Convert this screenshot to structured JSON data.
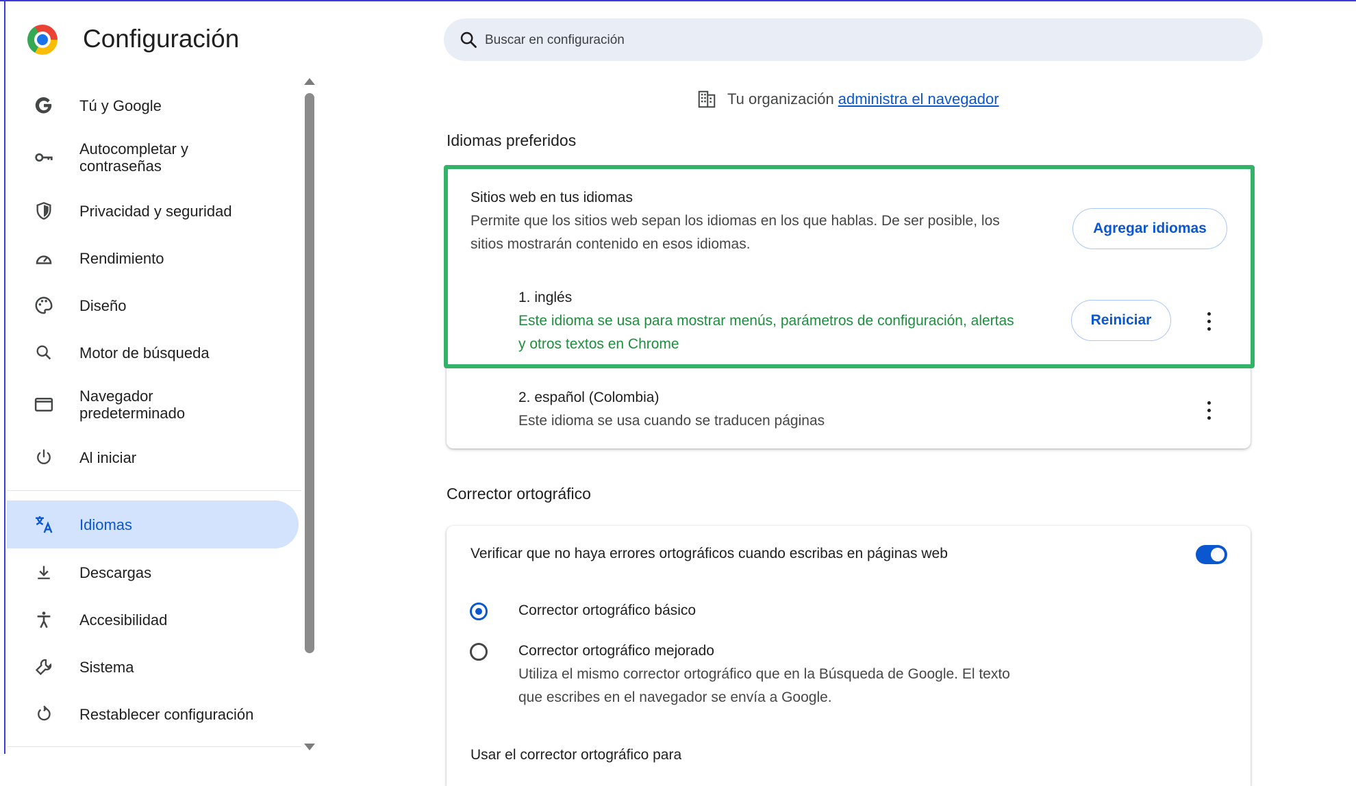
{
  "header": {
    "title": "Configuración",
    "search_placeholder": "Buscar en configuración"
  },
  "sidebar": {
    "items": [
      {
        "label": "Tú y Google",
        "icon": "google-g-icon"
      },
      {
        "label": "Autocompletar y contraseñas",
        "icon": "key-icon"
      },
      {
        "label": "Privacidad y seguridad",
        "icon": "shield-icon"
      },
      {
        "label": "Rendimiento",
        "icon": "speedometer-icon"
      },
      {
        "label": "Diseño",
        "icon": "palette-icon"
      },
      {
        "label": "Motor de búsqueda",
        "icon": "search-icon"
      },
      {
        "label": "Navegador predeterminado",
        "icon": "browser-window-icon"
      },
      {
        "label": "Al iniciar",
        "icon": "power-icon"
      },
      {
        "label": "Idiomas",
        "icon": "translate-icon",
        "active": true
      },
      {
        "label": "Descargas",
        "icon": "download-icon"
      },
      {
        "label": "Accesibilidad",
        "icon": "accessibility-icon"
      },
      {
        "label": "Sistema",
        "icon": "wrench-icon"
      },
      {
        "label": "Restablecer configuración",
        "icon": "reset-icon"
      }
    ]
  },
  "org_notice": {
    "text": "Tu organización",
    "link": "administra el navegador"
  },
  "languages": {
    "section_title": "Idiomas preferidos",
    "sites_title": "Sitios web en tus idiomas",
    "sites_desc_line1": "Permite que los sitios web sepan los idiomas en los que hablas. De ser posible, los",
    "sites_desc_line2": "sitios mostrarán contenido en esos idiomas.",
    "add_button": "Agregar idiomas",
    "list": [
      {
        "name": "1. inglés",
        "desc_line1": "Este idioma se usa para mostrar menús, parámetros de configuración, alertas",
        "desc_line2": "y otros textos en Chrome",
        "button": "Reiniciar"
      },
      {
        "name": "2. español (Colombia)",
        "desc_line1": "Este idioma se usa cuando se traducen páginas"
      }
    ]
  },
  "spellcheck": {
    "section_title": "Corrector ortográfico",
    "toggle_label": "Verificar que no haya errores ortográficos cuando escribas en páginas web",
    "toggle_on": true,
    "option_basic": "Corrector ortográfico básico",
    "option_enhanced": "Corrector ortográfico mejorado",
    "enhanced_desc_line1": "Utiliza el mismo corrector ortográfico que en la Búsqueda de Google. El texto",
    "enhanced_desc_line2": "que escribes en el navegador se envía a Google.",
    "use_for": "Usar el corrector ortográfico para"
  },
  "colors": {
    "accent": "#0b57d0",
    "active_nav_bg": "#d3e3fd",
    "highlight_border": "#34b26a",
    "green_text": "#1e8e3e"
  }
}
